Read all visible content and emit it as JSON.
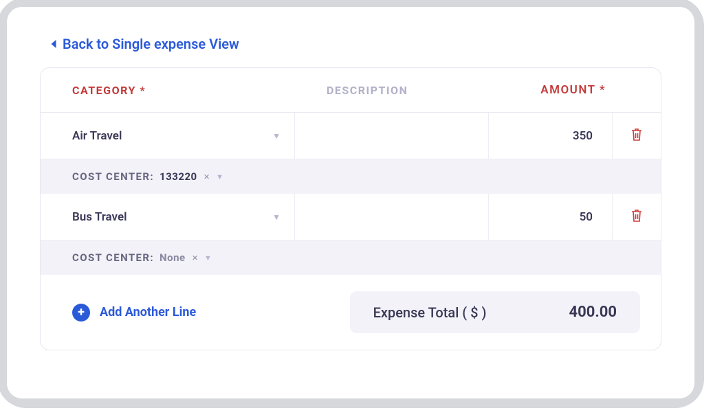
{
  "back_link": "Back to Single expense View",
  "headers": {
    "category": "CATEGORY *",
    "description": "DESCRIPTION",
    "amount": "AMOUNT *"
  },
  "cost_center_label": "COST CENTER:",
  "rows": [
    {
      "category": "Air Travel",
      "amount": "350",
      "cost_center": "133220"
    },
    {
      "category": "Bus Travel",
      "amount": "50",
      "cost_center": "None"
    }
  ],
  "add_line": "Add Another Line",
  "total_label": "Expense Total ( $ )",
  "total_value": "400.00"
}
